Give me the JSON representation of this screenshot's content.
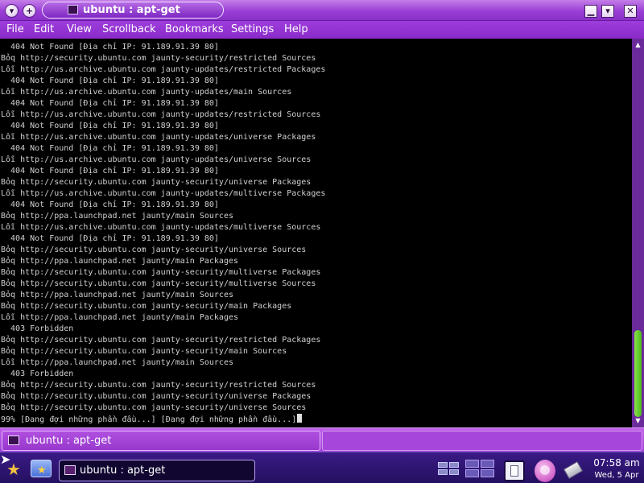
{
  "window": {
    "title": "ubuntu : apt-get",
    "menu_button_glyph": "▾",
    "sticky_button_glyph": "+",
    "minimize_glyph": "▁",
    "maximize_glyph": "▾",
    "close_glyph": "✕",
    "accent_color": "#9a3fd6"
  },
  "menubar": {
    "items": [
      "File",
      "Edit",
      "View",
      "Scrollback",
      "Bookmarks",
      "Settings",
      "Help"
    ]
  },
  "terminal": {
    "lines": [
      "  404 Not Found [Địa chỉ IP: 91.189.91.39 80]",
      "Bỏq http://security.ubuntu.com jaunty-security/restricted Sources",
      "Lỗi http://us.archive.ubuntu.com jaunty-updates/restricted Packages",
      "  404 Not Found [Địa chỉ IP: 91.189.91.39 80]",
      "Lỗi http://us.archive.ubuntu.com jaunty-updates/main Sources",
      "  404 Not Found [Địa chỉ IP: 91.189.91.39 80]",
      "Lỗi http://us.archive.ubuntu.com jaunty-updates/restricted Sources",
      "  404 Not Found [Địa chỉ IP: 91.189.91.39 80]",
      "Lỗi http://us.archive.ubuntu.com jaunty-updates/universe Packages",
      "  404 Not Found [Địa chỉ IP: 91.189.91.39 80]",
      "Lỗi http://us.archive.ubuntu.com jaunty-updates/universe Sources",
      "  404 Not Found [Địa chỉ IP: 91.189.91.39 80]",
      "Bỏq http://security.ubuntu.com jaunty-security/universe Packages",
      "Lỗi http://us.archive.ubuntu.com jaunty-updates/multiverse Packages",
      "  404 Not Found [Địa chỉ IP: 91.189.91.39 80]",
      "Bỏq http://ppa.launchpad.net jaunty/main Sources",
      "Lỗi http://us.archive.ubuntu.com jaunty-updates/multiverse Sources",
      "  404 Not Found [Địa chỉ IP: 91.189.91.39 80]",
      "Bỏq http://security.ubuntu.com jaunty-security/universe Sources",
      "Bỏq http://ppa.launchpad.net jaunty/main Packages",
      "Bỏq http://security.ubuntu.com jaunty-security/multiverse Packages",
      "Bỏq http://security.ubuntu.com jaunty-security/multiverse Sources",
      "Bỏq http://ppa.launchpad.net jaunty/main Sources",
      "Bỏq http://security.ubuntu.com jaunty-security/main Packages",
      "Lỗi http://ppa.launchpad.net jaunty/main Packages",
      "  403 Forbidden",
      "Bỏq http://security.ubuntu.com jaunty-security/restricted Packages",
      "Bỏq http://security.ubuntu.com jaunty-security/main Sources",
      "Lỗi http://ppa.launchpad.net jaunty/main Sources",
      "  403 Forbidden",
      "Bỏq http://security.ubuntu.com jaunty-security/restricted Sources",
      "Bỏq http://security.ubuntu.com jaunty-security/universe Packages",
      "Bỏq http://security.ubuntu.com jaunty-security/universe Sources",
      "99% [Đang đợi những phần đầu...] [Đang đợi những phần đầu...]"
    ],
    "scroll_up_glyph": "▲",
    "scroll_down_glyph": "▼"
  },
  "tabbar": {
    "session_label": "ubuntu : apt-get"
  },
  "taskbar": {
    "pointer_glyph": "➤",
    "kmenu_glyph": "★",
    "home_glyph": "★",
    "task_label": "ubuntu : apt-get",
    "clock_time": "07:58 am",
    "clock_date": "Wed, 5 Apr"
  }
}
